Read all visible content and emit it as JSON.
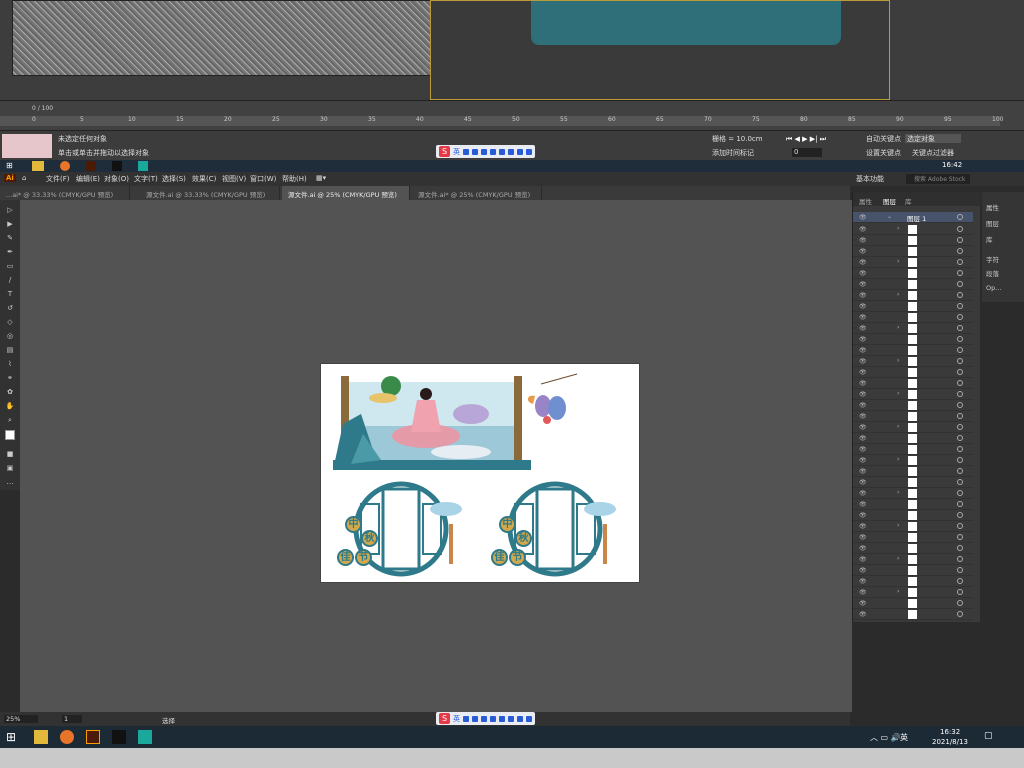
{
  "max": {
    "frame_counter": "0 / 100",
    "ruler_ticks": [
      "0",
      "5",
      "10",
      "15",
      "20",
      "25",
      "30",
      "35",
      "40",
      "45",
      "50",
      "55",
      "60",
      "65",
      "70",
      "75",
      "80",
      "85",
      "90",
      "95",
      "100"
    ],
    "status_line1": "未选定任何对象",
    "status_line2": "单击或单击并拖动以选择对象",
    "grid_label": "栅格 = 10.0cm",
    "add_time_tag": "添加时间标记",
    "auto_key": "自动关键点",
    "selected_object": "选定对象",
    "set_key": "设置关键点",
    "key_filter": "关键点过滤器",
    "frame_value": "0",
    "taskbar_time": "16:42",
    "ime_lang": "英"
  },
  "ai": {
    "logo": "Ai",
    "menu": [
      "文件(F)",
      "编辑(E)",
      "对象(O)",
      "文字(T)",
      "选择(S)",
      "效果(C)",
      "视图(V)",
      "窗口(W)",
      "帮助(H)"
    ],
    "workspace": "基本功能",
    "search_placeholder": "搜索 Adobe Stock",
    "tabs": [
      {
        "label": "...ai* @ 33.33% (CMYK/GPU 预览)"
      },
      {
        "label": "源文件.ai @ 33.33% (CMYK/GPU 预览)"
      },
      {
        "label": "源文件.ai @ 25% (CMYK/GPU 预览)"
      },
      {
        "label": "源文件.ai* @ 25% (CMYK/GPU 预览)"
      }
    ],
    "layers_tabs": [
      "属性",
      "图层",
      "库"
    ],
    "layer_name": "图层 1",
    "dock": [
      "属性",
      "图层",
      "库",
      "字符",
      "段落",
      "Op..."
    ],
    "zoom": "25%",
    "artboard_num": "1",
    "tool_status": "选择"
  },
  "artwork": {
    "chars1": [
      "中",
      "秋",
      "佳",
      "节"
    ],
    "chars2": [
      "中",
      "秋",
      "佳",
      "节"
    ]
  },
  "taskbar": {
    "time": "16:32",
    "date": "2021/8/13",
    "ime_lang": "英"
  },
  "colors": {
    "teal": "#2f7a8a",
    "gold": "#d2a84a",
    "sky": "#a9d3e6"
  }
}
